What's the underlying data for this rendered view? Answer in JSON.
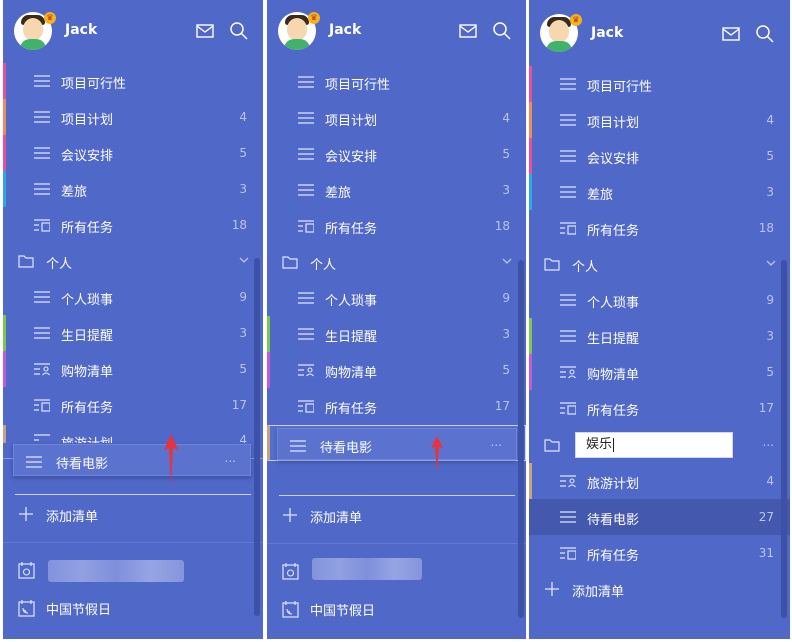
{
  "user": {
    "name": "Jack"
  },
  "colors": {
    "panel_bg": "#5068c8",
    "pink": "#e94f9b",
    "orange": "#ef8a5a",
    "blue": "#2aa8e8",
    "green": "#7cc84a",
    "magenta": "#c45ad8",
    "tan": "#c4a484",
    "arrow_red": "#e8323c"
  },
  "icons": {
    "mail": "mail-icon",
    "search": "search-icon",
    "list": "list-icon",
    "all_tasks": "all-tasks-icon",
    "folder": "folder-icon",
    "shopping": "shopping-list-icon",
    "plus": "plus-icon",
    "calendar": "calendar-icon",
    "holiday": "holiday-calendar-icon"
  },
  "lists": {
    "feasibility": {
      "label": "项目可行性",
      "count": ""
    },
    "plan": {
      "label": "项目计划",
      "count": "4"
    },
    "meeting": {
      "label": "会议安排",
      "count": "5"
    },
    "trip": {
      "label": "差旅",
      "count": "3"
    },
    "all1": {
      "label": "所有任务",
      "count": "18"
    },
    "group_personal": {
      "label": "个人"
    },
    "errands": {
      "label": "个人琐事",
      "count": "9"
    },
    "birthday": {
      "label": "生日提醒",
      "count": "3"
    },
    "shopping": {
      "label": "购物清单",
      "count": "5"
    },
    "all2": {
      "label": "所有任务",
      "count": "17"
    }
  },
  "panel1": {
    "partial_row": {
      "label": "旅游计划",
      "count": "4"
    },
    "dragged_item": {
      "label": "待看电影",
      "more": "..."
    }
  },
  "panel2": {
    "dragged_item": {
      "label": "待看电影",
      "more": "..."
    }
  },
  "panel3": {
    "rename_value": "娱乐",
    "group_more": "...",
    "travel": {
      "label": "旅游计划",
      "count": "4"
    },
    "movies": {
      "label": "待看电影",
      "count": "27"
    },
    "all3": {
      "label": "所有任务",
      "count": "31"
    }
  },
  "footer": {
    "add_list": "添加清单",
    "holiday": "中国节假日"
  }
}
